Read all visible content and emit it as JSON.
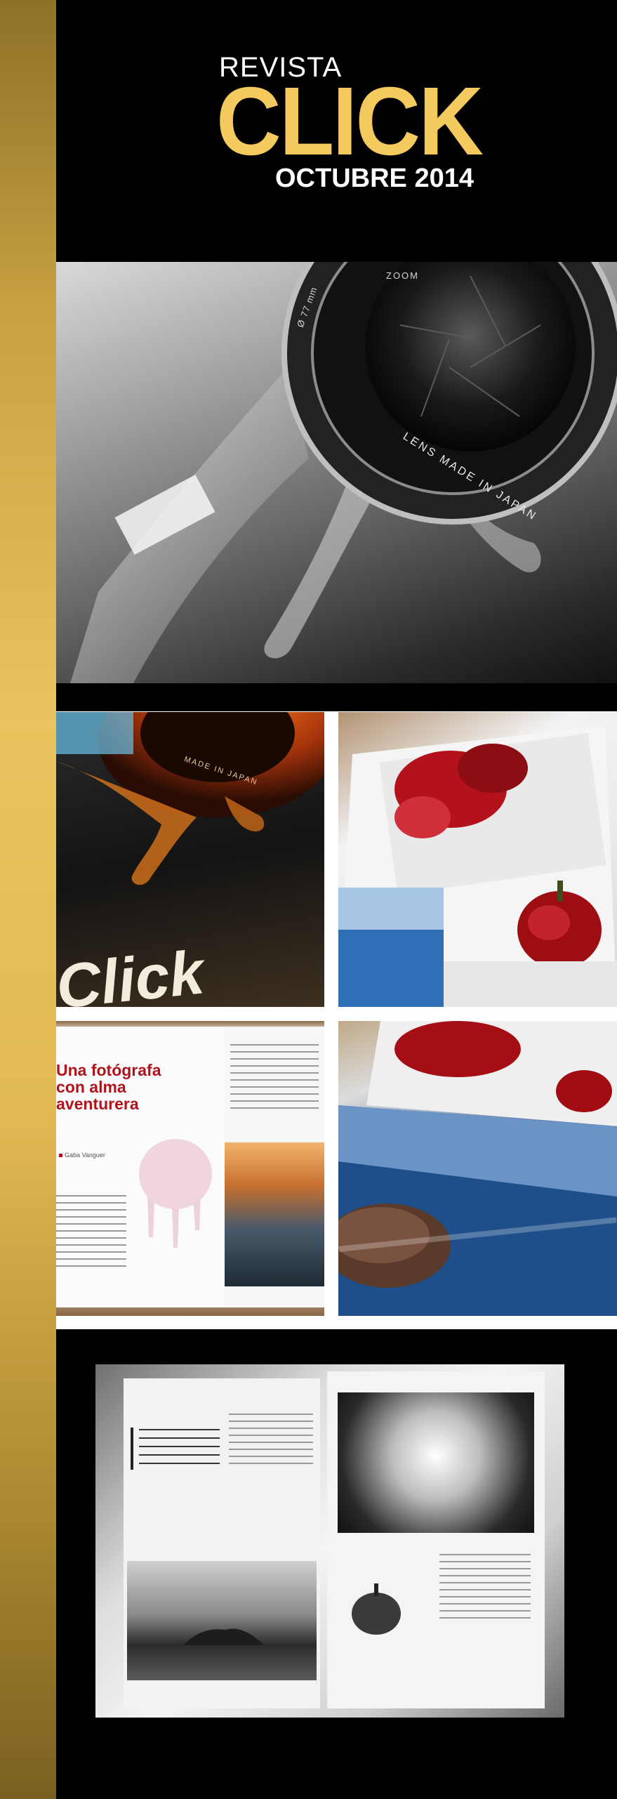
{
  "header": {
    "kicker": "REVISTA",
    "title": "CLICK",
    "issue_date": "OCTUBRE 2014"
  },
  "hero_lens": {
    "ring_text_1": "LENS MADE IN JAPAN",
    "ring_text_2": "ZOOM",
    "ring_text_3": "Ø 77 mm"
  },
  "cover_photo": {
    "lens_text": "MADE IN JAPAN",
    "wordmark": "Click"
  },
  "article_spread": {
    "title_line_1": "Una fotógrafa",
    "title_line_2": "con alma",
    "title_line_3": "aventurera",
    "byline": "Gaba Vanguer"
  },
  "colors": {
    "accent_gold": "#f4c95d",
    "strip_gold": "#e2b953",
    "headline_red": "#b0141b",
    "background_black": "#000000"
  }
}
